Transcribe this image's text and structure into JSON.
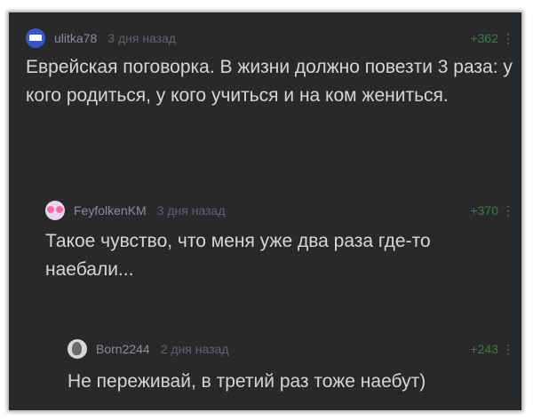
{
  "comments": [
    {
      "user": "ulitka78",
      "time": "3 дня назад",
      "rating": "+362",
      "more": "⋮",
      "text": "Еврейская поговорка. В жизни должно повезти 3 раза: у кого родиться, у кого учиться и на ком жениться."
    },
    {
      "user": "FeyfolkenKM",
      "time": "3 дня назад",
      "rating": "+370",
      "more": "⋮",
      "text": "Такое чувство, что меня уже два раза где-то наебали..."
    },
    {
      "user": "Born2244",
      "time": "2 дня назад",
      "rating": "+243",
      "more": "⋮",
      "text": "Не переживай, в третий раз тоже наебут)"
    }
  ],
  "colors": {
    "background": "#28292b",
    "rating": "#3d7a3f",
    "text": "#d4d6d8",
    "username": "#8a8f95"
  },
  "icons": [
    "avatar-ulitka78",
    "avatar-feyfolkenkm",
    "avatar-born2244",
    "more-vertical-icon"
  ]
}
